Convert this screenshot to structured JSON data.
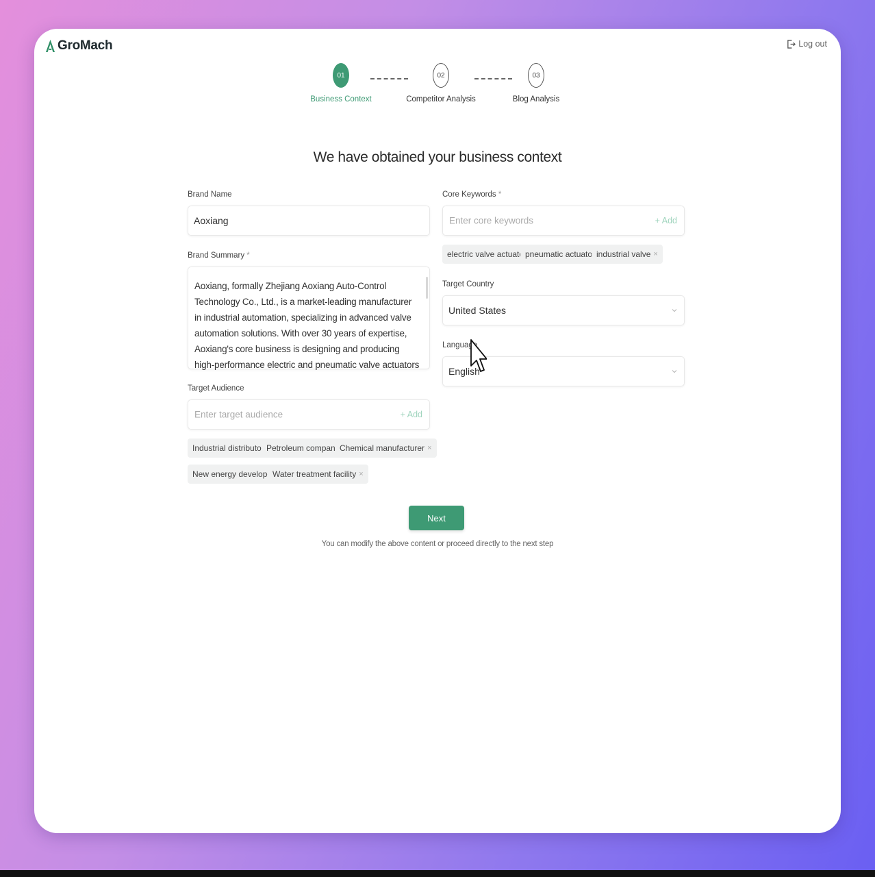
{
  "app": {
    "logo_text": "GroMach",
    "logout_label": "Log out"
  },
  "steps": [
    {
      "number": "01",
      "label": "Business Context",
      "active": true
    },
    {
      "number": "02",
      "label": "Competitor Analysis",
      "active": false
    },
    {
      "number": "03",
      "label": "Blog Analysis",
      "active": false
    }
  ],
  "heading": "We have obtained your business context",
  "form": {
    "brand_name": {
      "label": "Brand Name",
      "value": "Aoxiang"
    },
    "brand_summary": {
      "label": "Brand Summary",
      "required_mark": "*",
      "value": "Aoxiang, formally Zhejiang Aoxiang Auto-Control Technology Co., Ltd., is a market-leading manufacturer in industrial automation, specializing in advanced valve automation solutions. With over 30 years of expertise, Aoxiang's core business is designing and producing high-performance electric and pneumatic valve actuators and valves. The company provides efficient, cost-effective, and scalable solutions, helping clients reduce"
    },
    "target_audience": {
      "label": "Target Audience",
      "placeholder": "Enter target audience",
      "add_label": "+ Add",
      "tags": [
        "Industrial distributor",
        "Petroleum company",
        "Chemical manufacturer",
        "New energy developer",
        "Water treatment facility"
      ]
    },
    "core_keywords": {
      "label": "Core Keywords",
      "required_mark": "*",
      "placeholder": "Enter core keywords",
      "add_label": "+ Add",
      "tags": [
        "electric valve actuator",
        "pneumatic actuator",
        "industrial valve"
      ]
    },
    "target_country": {
      "label": "Target Country",
      "value": "United States"
    },
    "language": {
      "label": "Language",
      "value": "English"
    }
  },
  "actions": {
    "next_label": "Next",
    "hint": "You can modify the above content or proceed directly to the next step"
  },
  "colors": {
    "accent": "#3e9a74",
    "add_text": "#9fd4bd"
  },
  "tag_remove_glyph": "×"
}
